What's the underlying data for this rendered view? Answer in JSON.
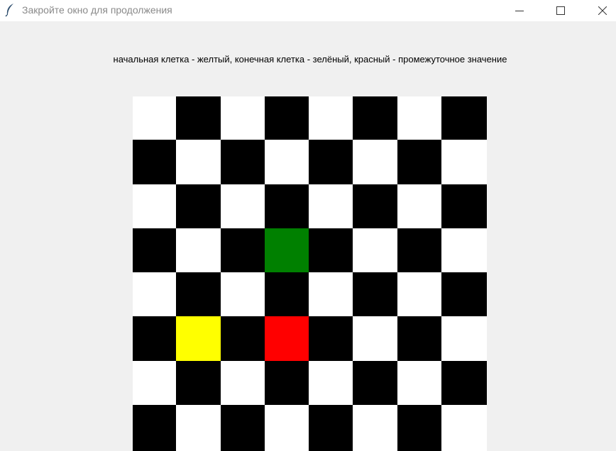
{
  "window": {
    "title": "Закройте окно для продолжения",
    "icon": "feather-icon",
    "controls": [
      "minimize-icon",
      "maximize-icon",
      "close-icon"
    ]
  },
  "caption": "начальная клетка - желтый, конечная клетка - зелёный, красный - промежуточное значение",
  "board": {
    "rows": 8,
    "cols": 8,
    "colors": {
      "light": "#ffffff",
      "dark": "#000000",
      "start": "#ffff00",
      "end": "#008000",
      "intermediate": "#ff0000"
    },
    "start_cell": [
      5,
      1
    ],
    "end_cell": [
      3,
      3
    ],
    "intermediate_cells": [
      [
        5,
        3
      ]
    ]
  }
}
